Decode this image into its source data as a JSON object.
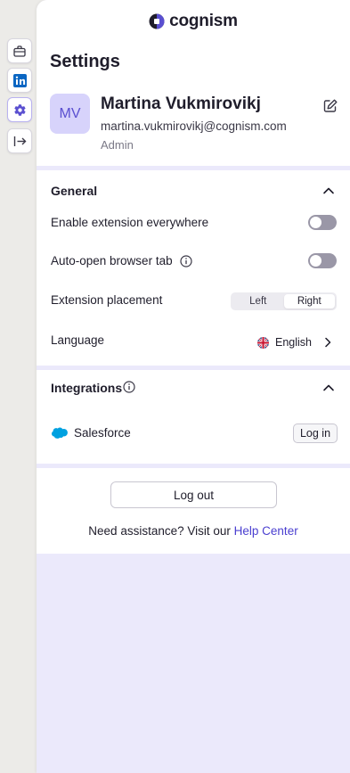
{
  "rail": {
    "items": [
      {
        "icon": "briefcase-icon"
      },
      {
        "icon": "linkedin-icon"
      },
      {
        "icon": "gear-icon",
        "active": true
      },
      {
        "icon": "collapse-icon"
      }
    ]
  },
  "brand": {
    "name": "cognism",
    "accent": "#5a4fd0"
  },
  "header": {
    "title": "Settings"
  },
  "user": {
    "initials": "MV",
    "name": "Martina Vukmirovikj",
    "email": "martina.vukmirovikj@cognism.com",
    "role": "Admin"
  },
  "general": {
    "title": "General",
    "enable_everywhere_label": "Enable extension everywhere",
    "enable_everywhere_on": false,
    "auto_open_label": "Auto-open browser tab",
    "auto_open_on": false,
    "placement_label": "Extension placement",
    "placement_options": [
      "Left",
      "Right"
    ],
    "placement_selected": "Right",
    "language_label": "Language",
    "language_value": "English"
  },
  "integrations": {
    "title": "Integrations",
    "salesforce_label": "Salesforce",
    "login_label": "Log in"
  },
  "footer": {
    "logout_label": "Log out",
    "help_text": "Need assistance? Visit our",
    "help_link": "Help Center"
  }
}
